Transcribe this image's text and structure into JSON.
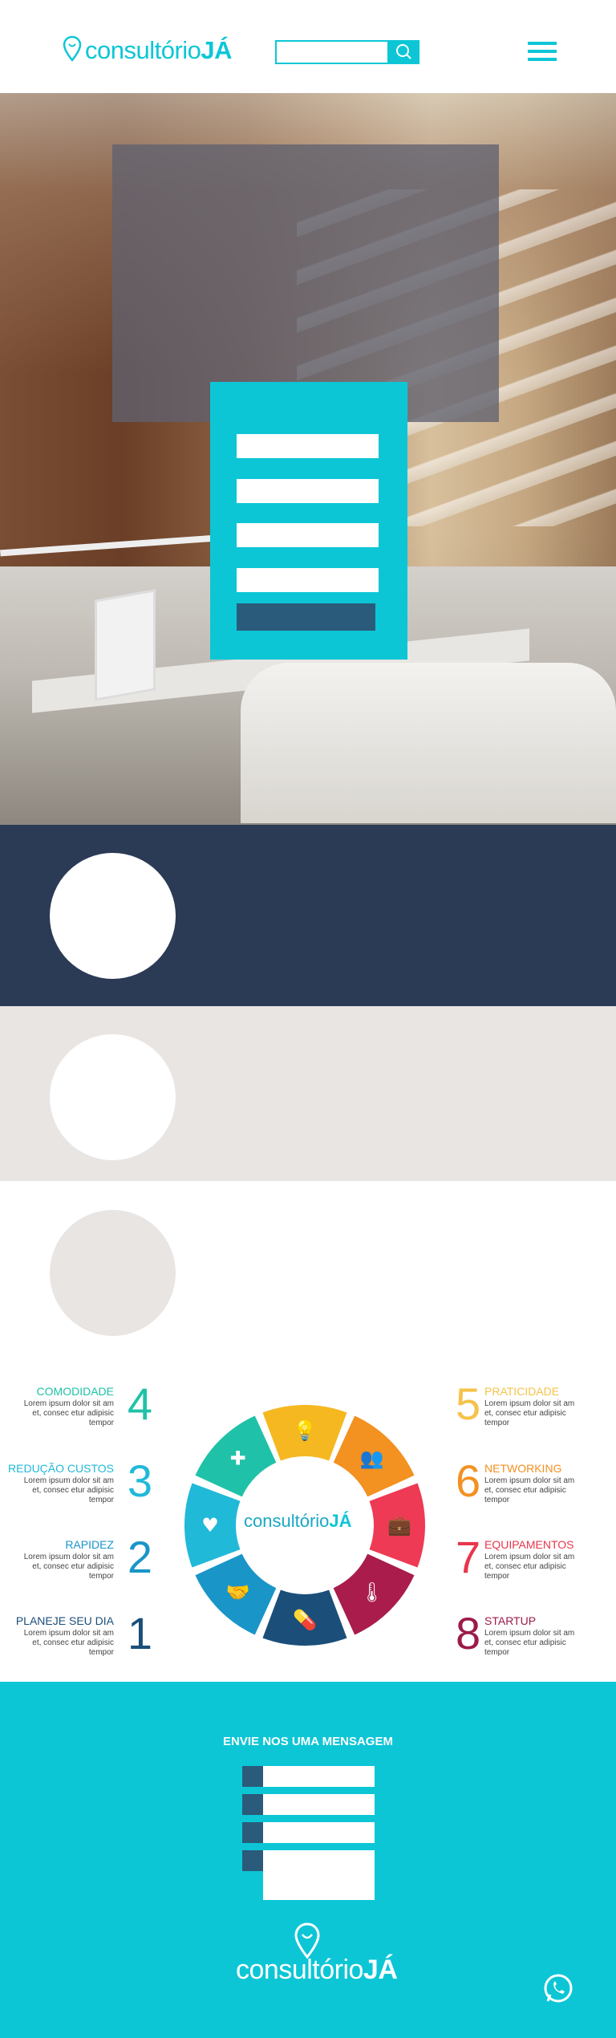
{
  "brand": {
    "logo_light": "consultório",
    "logo_bold": "JÁ",
    "primary_color": "#0cc6d6",
    "dark_color": "#2b3a55",
    "gray_color": "#e8e5e3"
  },
  "header": {
    "search_placeholder": "",
    "search_icon": "search-icon",
    "menu_icon": "hamburger-menu-icon"
  },
  "infographic": {
    "left": [
      {
        "num": "4",
        "title": "COMODIDADE",
        "text": "Lorem ipsum dolor sit am et, consec etur adipisic tempor",
        "color": "#1fc2a8"
      },
      {
        "num": "3",
        "title": "REDUÇÃO CUSTOS",
        "text": "Lorem ipsum dolor sit am et, consec etur adipisic tempor",
        "color": "#21b9d8"
      },
      {
        "num": "2",
        "title": "RAPIDEZ",
        "text": "Lorem ipsum dolor sit am et, consec etur adipisic tempor",
        "color": "#1a95c8"
      },
      {
        "num": "1",
        "title": "PLANEJE SEU DIA",
        "text": "Lorem ipsum dolor sit am et, consec etur adipisic tempor",
        "color": "#1b4f7a"
      }
    ],
    "right": [
      {
        "num": "5",
        "title": "PRATICIDADE",
        "text": "Lorem ipsum dolor sit am et, consec etur adipisic tempor",
        "color": "#f5c34a"
      },
      {
        "num": "6",
        "title": "NETWORKING",
        "text": "Lorem ipsum dolor sit am et, consec etur adipisic tempor",
        "color": "#f39121"
      },
      {
        "num": "7",
        "title": "EQUIPAMENTOS",
        "text": "Lorem ipsum dolor sit am et, consec etur adipisic tempor",
        "color": "#e8364d"
      },
      {
        "num": "8",
        "title": "STARTUP",
        "text": "Lorem ipsum dolor sit am et, consec etur adipisic tempor",
        "color": "#9c1b4a"
      }
    ],
    "wheel_logo_light": "consultório",
    "wheel_logo_bold": "JÁ",
    "segments": [
      {
        "icon": "lightbulb-icon",
        "color": "#f5b820"
      },
      {
        "icon": "people-icon",
        "color": "#f39121"
      },
      {
        "icon": "briefcase-icon",
        "color": "#ee3a54"
      },
      {
        "icon": "thermometer-icon",
        "color": "#a91c4c"
      },
      {
        "icon": "pill-icon",
        "color": "#1b4f7a"
      },
      {
        "icon": "handshake-icon",
        "color": "#1a95c8"
      },
      {
        "icon": "heartbeat-icon",
        "color": "#21b9d8"
      },
      {
        "icon": "medical-cross-icon",
        "color": "#1fc2a8"
      }
    ]
  },
  "footer": {
    "title": "ENVIE NOS UMA MENSAGEM",
    "logo_light": "consultório",
    "logo_bold": "JÁ",
    "whatsapp_icon": "whatsapp-icon"
  }
}
